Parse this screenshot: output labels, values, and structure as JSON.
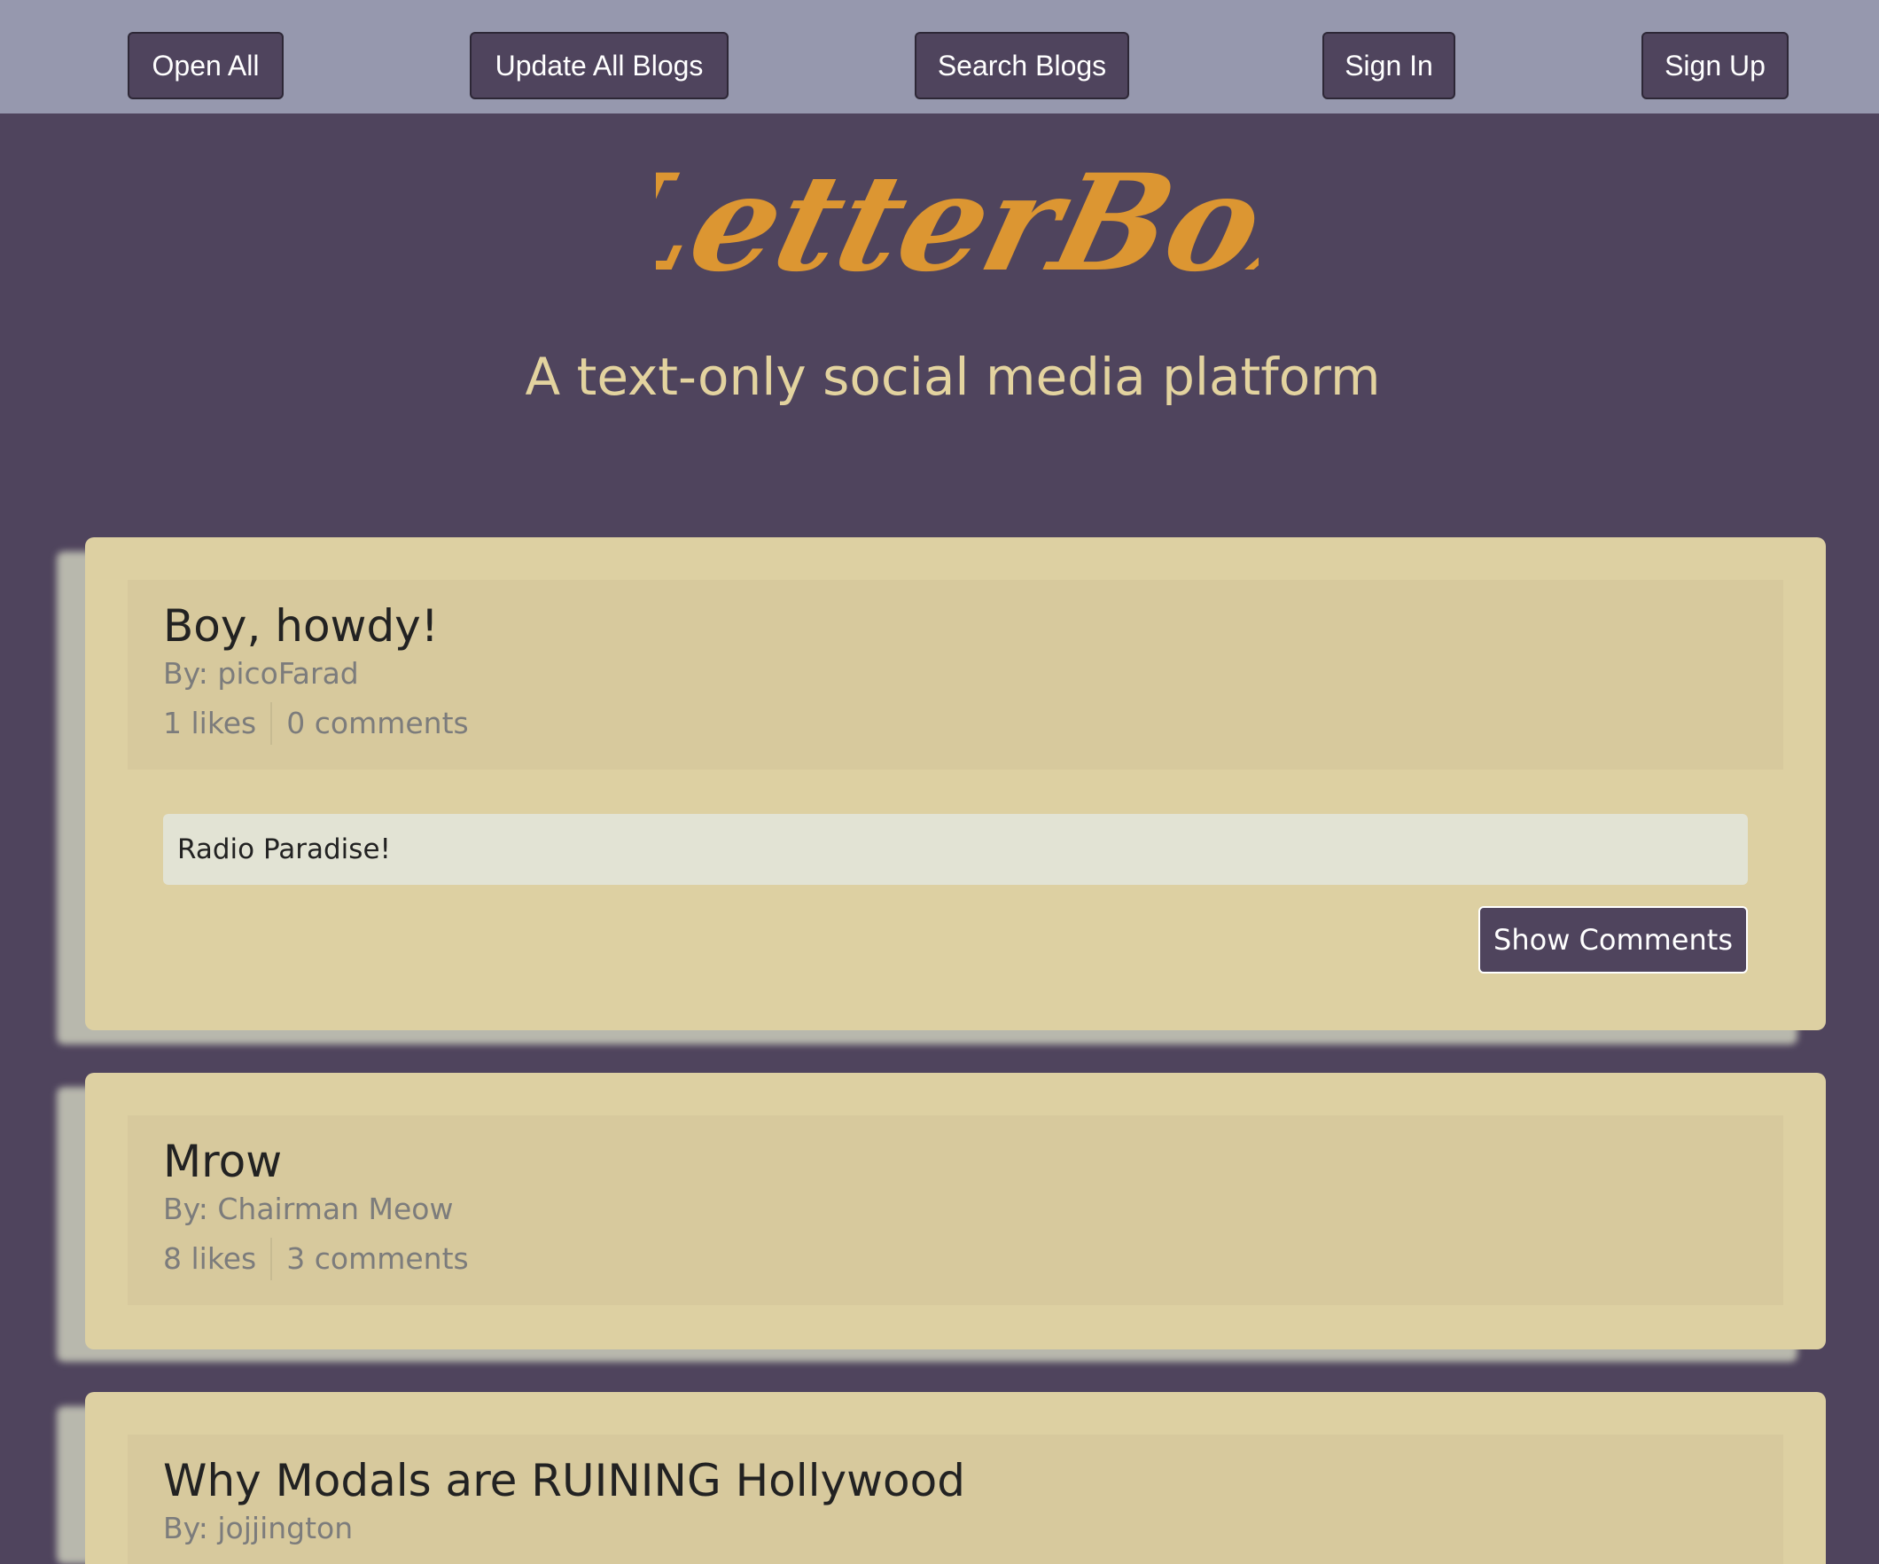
{
  "nav": {
    "open_all": "Open All",
    "update_all_blogs": "Update All Blogs",
    "search_blogs": "Search Blogs",
    "sign_in": "Sign In",
    "sign_up": "Sign Up"
  },
  "hero": {
    "logo_text": "LetterBox",
    "tagline": "A text-only social media platform"
  },
  "posts": [
    {
      "title": "Boy, howdy!",
      "author": "By: picoFarad",
      "likes": "1 likes",
      "comments": "0 comments",
      "body": "Radio Paradise!",
      "show_comments_label": "Show Comments"
    },
    {
      "title": "Mrow",
      "author": "By: Chairman Meow",
      "likes": "8 likes",
      "comments": "3 comments"
    },
    {
      "title": "Why Modals are RUINING Hollywood",
      "author": "By: jojjington"
    }
  ],
  "colors": {
    "navbar_bg": "#9698ae",
    "page_bg": "#4f445d",
    "button_bg": "#4f445d",
    "logo": "#dc9632",
    "tagline": "#e3d39f",
    "card_bg": "#ddd0a2",
    "card_header_bg": "#d7c99d",
    "post_body_bg": "#e2e3d4"
  }
}
